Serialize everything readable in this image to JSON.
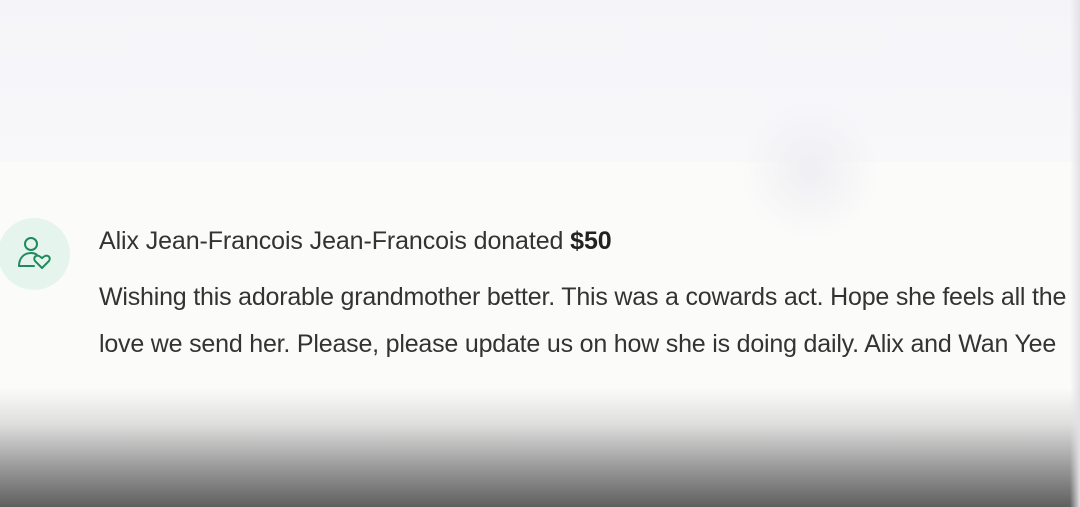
{
  "donation": {
    "donor_name": "Alix Jean-Francois Jean-Francois",
    "action_text": "donated",
    "amount": "$50",
    "message": "Wishing this adorable grandmother better. This was a cowards act. Hope she feels all the love we send her. Please, please update us on how she is doing daily. Alix and Wan Yee",
    "avatar_icon": "donor-heart-icon"
  },
  "colors": {
    "avatar_bg": "#e5f5ee",
    "avatar_icon": "#1f8a5b",
    "text": "#333333"
  }
}
